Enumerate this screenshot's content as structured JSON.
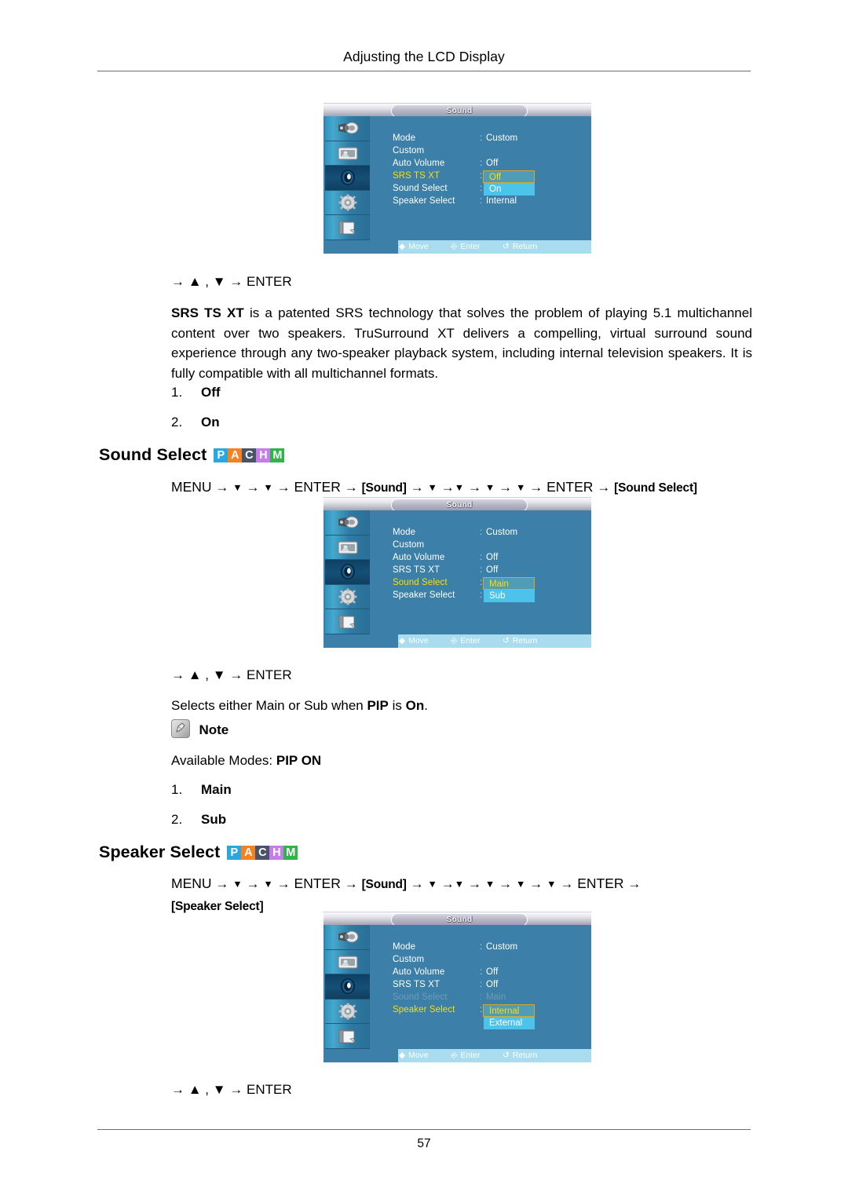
{
  "header": {
    "title": "Adjusting the LCD Display"
  },
  "footer": {
    "page_number": "57"
  },
  "colors": {
    "badge_p": "#29a7df",
    "badge_a": "#f58220",
    "badge_c": "#4a5468",
    "badge_h": "#c77de8",
    "badge_m": "#2fb44a",
    "osd_bg": "#3c7fa8",
    "osd_highlight_text": "#ffdf00",
    "osd_option_selected_border": "#d8a62a",
    "osd_option_alt_bg": "#4cc3ea",
    "osd_footer_bg": "#a9dcee"
  },
  "sections": [
    {
      "id": "srs-ts-xt",
      "key_line": "→ ▲ , ▼ → ENTER",
      "paragraph_bold": "SRS TS XT",
      "paragraph_rest": " is a patented SRS technology that solves the problem of playing 5.1 multichannel content over two speakers. TruSurround XT delivers a compelling, virtual surround sound experience through any two-speaker playback system, including internal television speakers. It is fully compatible with all multichannel formats.",
      "options": [
        {
          "num": "1.",
          "value": "Off"
        },
        {
          "num": "2.",
          "value": "On"
        }
      ]
    },
    {
      "id": "sound-select",
      "heading": "Sound Select",
      "badges": [
        "P",
        "A",
        "C",
        "H",
        "M"
      ],
      "nav": {
        "menu": "MENU",
        "enter": "ENTER",
        "sound_tag": "[Sound]",
        "target_tag": "[Sound Select]"
      },
      "key_line": "→ ▲ , ▼ → ENTER",
      "description_pre": "Selects either Main or Sub when ",
      "description_bold1": "PIP",
      "description_mid": " is ",
      "description_bold2": "On",
      "description_post": ".",
      "note_label": "Note",
      "available_modes_label": "Available Modes: ",
      "available_modes_value": "PIP ON",
      "options": [
        {
          "num": "1.",
          "value": "Main"
        },
        {
          "num": "2.",
          "value": "Sub"
        }
      ]
    },
    {
      "id": "speaker-select",
      "heading": "Speaker Select",
      "badges": [
        "P",
        "A",
        "C",
        "H",
        "M"
      ],
      "nav": {
        "menu": "MENU",
        "enter": "ENTER",
        "sound_tag": "[Sound]",
        "target_tag": "[Speaker Select]"
      },
      "key_line": "→ ▲ , ▼ → ENTER"
    }
  ],
  "osd_screens": [
    {
      "id": "osd-srs",
      "title": "Sound",
      "rows": [
        {
          "label": "Mode",
          "colon": ":",
          "value": "Custom",
          "state": "normal"
        },
        {
          "label": "Custom",
          "colon": "",
          "value": "",
          "state": "normal"
        },
        {
          "label": "Auto Volume",
          "colon": ":",
          "value": "Off",
          "state": "normal"
        },
        {
          "label": "SRS TS XT",
          "colon": ":",
          "value": "",
          "state": "highlight"
        },
        {
          "label": "Sound Select",
          "colon": ":",
          "value": "",
          "state": "normal"
        },
        {
          "label": "Speaker Select",
          "colon": ":",
          "value": "Internal",
          "state": "normal"
        }
      ],
      "dropdown": {
        "selected": "Off",
        "alternate": "On"
      },
      "footer": {
        "move": "Move",
        "enter": "Enter",
        "return": "Return"
      }
    },
    {
      "id": "osd-sound-select",
      "title": "Sound",
      "rows": [
        {
          "label": "Mode",
          "colon": ":",
          "value": "Custom",
          "state": "normal"
        },
        {
          "label": "Custom",
          "colon": "",
          "value": "",
          "state": "normal"
        },
        {
          "label": "Auto Volume",
          "colon": ":",
          "value": "Off",
          "state": "normal"
        },
        {
          "label": "SRS TS XT",
          "colon": ":",
          "value": "Off",
          "state": "normal"
        },
        {
          "label": "Sound Select",
          "colon": ":",
          "value": "",
          "state": "highlight"
        },
        {
          "label": "Speaker Select",
          "colon": ":",
          "value": "",
          "state": "normal"
        }
      ],
      "dropdown": {
        "selected": "Main",
        "alternate": "Sub"
      },
      "footer": {
        "move": "Move",
        "enter": "Enter",
        "return": "Return"
      }
    },
    {
      "id": "osd-speaker-select",
      "title": "Sound",
      "rows": [
        {
          "label": "Mode",
          "colon": ":",
          "value": "Custom",
          "state": "normal"
        },
        {
          "label": "Custom",
          "colon": "",
          "value": "",
          "state": "normal"
        },
        {
          "label": "Auto Volume",
          "colon": ":",
          "value": "Off",
          "state": "normal"
        },
        {
          "label": "SRS TS XT",
          "colon": ":",
          "value": "Off",
          "state": "normal"
        },
        {
          "label": "Sound Select",
          "colon": ":",
          "value": "Main",
          "state": "dim"
        },
        {
          "label": "Speaker Select",
          "colon": ":",
          "value": "",
          "state": "highlight"
        }
      ],
      "dropdown": {
        "selected": "Internal",
        "alternate": "External"
      },
      "footer": {
        "move": "Move",
        "enter": "Enter",
        "return": "Return"
      }
    }
  ],
  "osd_sidebar_icons": [
    "input-source-icon",
    "picture-icon",
    "sound-icon",
    "setup-gear-icon",
    "multi-control-icon"
  ]
}
